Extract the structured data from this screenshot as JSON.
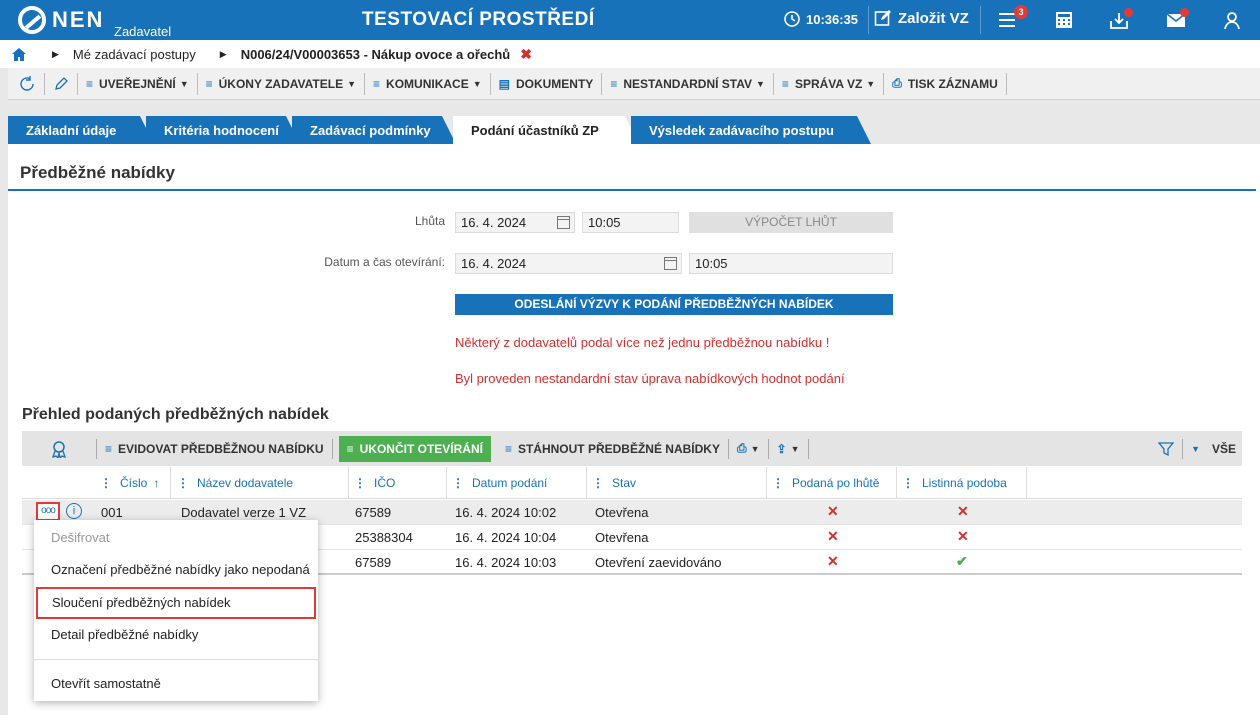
{
  "topbar": {
    "logo_text": "NEN",
    "logo_sub": "Zadavatel",
    "env_title": "TESTOVACÍ PROSTŘEDÍ",
    "time": "10:36:35",
    "create_vz": "Založit VZ",
    "menu_badge": "3"
  },
  "breadcrumb": {
    "items": [
      "Mé zadávací postupy",
      "N006/24/V00003653 - Nákup ovoce a ořechů"
    ]
  },
  "toolbar": {
    "uverejneni": "UVEŘEJNĚNÍ",
    "ukony": "ÚKONY ZADAVATELE",
    "komunikace": "KOMUNIKACE",
    "dokumenty": "DOKUMENTY",
    "nestandardni": "NESTANDARDNÍ STAV",
    "sprava": "SPRÁVA VZ",
    "tisk": "TISK ZÁZNAMU"
  },
  "tabs": [
    "Základní údaje",
    "Kritéria hodnocení",
    "Zadávací podmínky",
    "Podání účastníků ZP",
    "Výsledek zadávacího postupu"
  ],
  "section": {
    "title": "Předběžné nabídky",
    "lhuta_label": "Lhůta",
    "lhuta_date": "16. 4. 2024",
    "lhuta_time": "10:05",
    "vypocet_btn": "VÝPOČET LHŮT",
    "otevirani_label": "Datum a čas otevírání:",
    "otevirani_date": "16. 4. 2024",
    "otevirani_time": "10:05",
    "odeslani_btn": "ODESLÁNÍ VÝZVY K PODÁNÍ PŘEDBĚŽNÝCH NABÍDEK",
    "warning1": "Některý z dodavatelů podal více než jednu předběžnou nabídku !",
    "warning2": "Byl proveden nestandardní stav úprava nabídkových hodnot podání"
  },
  "grid": {
    "title": "Přehled podaných předběžných nabídek",
    "evidovat": "EVIDOVAT PŘEDBĚŽNOU NABÍDKU",
    "ukoncit": "UKONČIT OTEVÍRÁNÍ",
    "stahnout": "STÁHNOUT PŘEDBĚŽNÉ NABÍDKY",
    "filter_all": "VŠE",
    "columns": [
      "Číslo",
      "Název dodavatele",
      "IČO",
      "Datum podání",
      "Stav",
      "Podaná po lhůtě",
      "Listinná podoba"
    ],
    "rows": [
      {
        "cislo": "001",
        "nazev": "Dodavatel verze 1 VZ",
        "ico": "67589",
        "datum": "16. 4. 2024 10:02",
        "stav": "Otevřena",
        "po_lhute": "x",
        "listinna": "x"
      },
      {
        "cislo": "",
        "nazev": "",
        "ico": "25388304",
        "datum": "16. 4. 2024 10:04",
        "stav": "Otevřena",
        "po_lhute": "x",
        "listinna": "x"
      },
      {
        "cislo": "",
        "nazev": "",
        "ico": "67589",
        "datum": "16. 4. 2024 10:03",
        "stav": "Otevření zaevidováno",
        "po_lhute": "x",
        "listinna": "check"
      }
    ]
  },
  "context_menu": {
    "items": [
      "Dešifrovat",
      "Označení předběžné nabídky jako nepodaná",
      "Sloučení předběžných nabídek",
      "Detail předběžné nabídky",
      "Otevřít samostatně"
    ]
  },
  "colors": {
    "primary": "#1872ba",
    "accent_red": "#d32f2f",
    "green": "#4caf50"
  }
}
